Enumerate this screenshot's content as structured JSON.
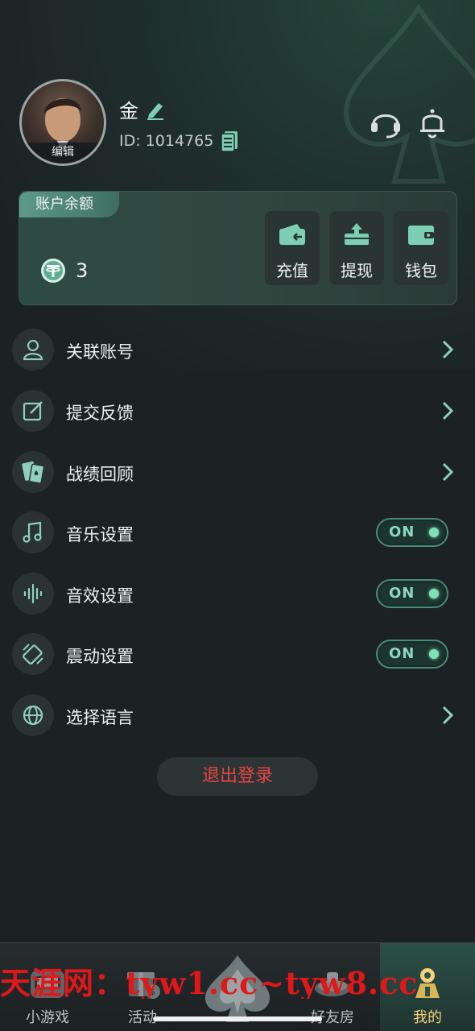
{
  "profile": {
    "username": "金",
    "id_text": "ID: 1014765",
    "avatar_edit": "编辑"
  },
  "header_icons": [
    "headset-icon",
    "bell-icon"
  ],
  "balance": {
    "tab_label": "账户余额",
    "amount": "3",
    "currency_icon": "tether-coin-icon",
    "actions": [
      {
        "label": "充值",
        "icon": "deposit-wallet-icon"
      },
      {
        "label": "提现",
        "icon": "withdraw-tray-icon"
      },
      {
        "label": "钱包",
        "icon": "wallet-icon"
      }
    ]
  },
  "menu": {
    "items": [
      {
        "label": "关联账号",
        "icon": "user-icon",
        "control": "chevron"
      },
      {
        "label": "提交反馈",
        "icon": "edit-icon",
        "control": "chevron"
      },
      {
        "label": "战绩回顾",
        "icon": "cards-icon",
        "control": "chevron"
      },
      {
        "label": "音乐设置",
        "icon": "music-note-icon",
        "control": "toggle",
        "toggle_text": "ON",
        "on": true
      },
      {
        "label": "音效设置",
        "icon": "sound-wave-icon",
        "control": "toggle",
        "toggle_text": "ON",
        "on": true
      },
      {
        "label": "震动设置",
        "icon": "vibration-icon",
        "control": "toggle",
        "toggle_text": "ON",
        "on": true
      },
      {
        "label": "选择语言",
        "icon": "globe-icon",
        "control": "chevron"
      }
    ]
  },
  "logout_label": "退出登录",
  "bottom_nav": {
    "items": [
      {
        "label": "小游戏",
        "icon": "slot-machine-icon"
      },
      {
        "label": "活动",
        "icon": "gift-icon"
      },
      {
        "label": "好友房",
        "icon": "poker-table-icon"
      },
      {
        "label": "我的",
        "icon": "profile-icon",
        "active": true
      }
    ],
    "center_icon": "spade-icon"
  },
  "watermark": "天涯网：tyw1.cc~tyw8.cc",
  "colors": {
    "accent": "#7fe1b8",
    "logout_red": "#e9443f",
    "active_nav": "#f4d27a",
    "background": "#1c2123"
  }
}
